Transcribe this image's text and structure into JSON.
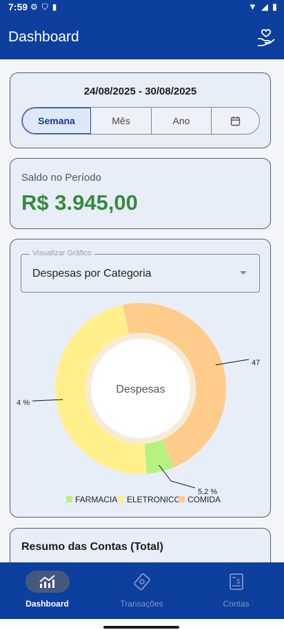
{
  "status_bar": {
    "time": "7:59"
  },
  "app_bar": {
    "title": "Dashboard"
  },
  "period": {
    "range": "24/08/2025 - 30/08/2025",
    "segments": [
      "Semana",
      "Mês",
      "Ano"
    ],
    "selected": "Semana"
  },
  "saldo": {
    "label": "Saldo no Período",
    "value": "R$ 3.945,00"
  },
  "chart_select": {
    "label": "Visualizar Gráfico",
    "value": "Despesas por Categoria"
  },
  "chart_data": {
    "type": "pie",
    "center_label": "Despesas",
    "slices": [
      {
        "name": "COMIDA",
        "value": 47,
        "color": "#ffcc8c"
      },
      {
        "name": "FARMACIA",
        "value": 5.2,
        "color": "#b6f280"
      },
      {
        "name": "ELETRONICO",
        "value": 47.8,
        "color": "#fff08c"
      }
    ],
    "data_labels": [
      "47",
      "5.2 %",
      "4 %"
    ],
    "legend": [
      "FARMACIA",
      "ELETRONICO",
      "COMIDA"
    ],
    "legend_colors": [
      "#b6f280",
      "#fff08c",
      "#ffcc8c"
    ],
    "legend_position": "bottom"
  },
  "summary": {
    "title": "Resumo das Contas (Total)"
  },
  "nav": {
    "items": [
      {
        "label": "Dashboard",
        "active": true
      },
      {
        "label": "Transações",
        "active": false
      },
      {
        "label": "Contas",
        "active": false
      }
    ]
  },
  "colors": {
    "primary": "#0c3f9e",
    "positive": "#378a3e",
    "card_bg": "#e8eef8"
  }
}
